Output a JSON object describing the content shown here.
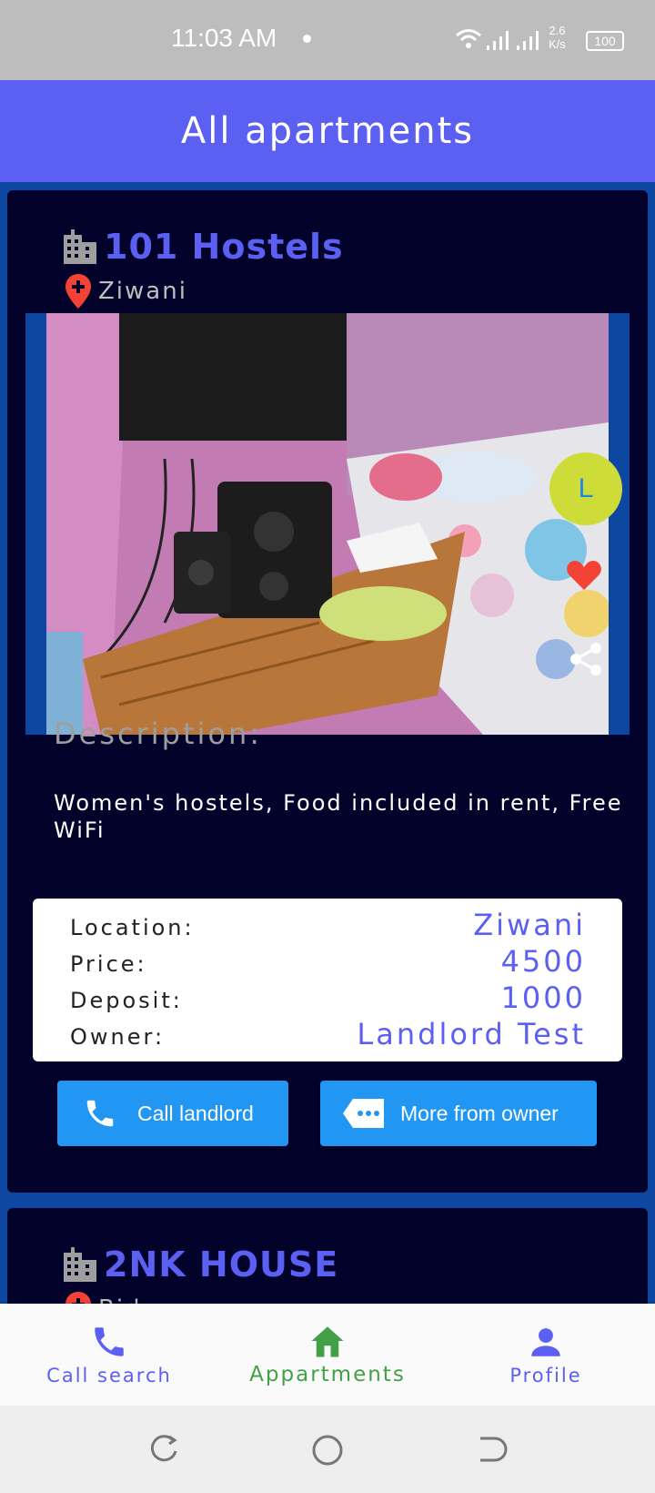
{
  "status_bar": {
    "time": "11:03 AM",
    "speed_value": "2.6",
    "speed_unit": "K/s",
    "battery": "100"
  },
  "app_bar": {
    "title": "All apartments"
  },
  "listings": [
    {
      "title": "101 Hostels",
      "location": "Ziwani",
      "owner_initial": "L",
      "description_label": "Description:",
      "description": "Women's hostels, Food included in rent, Free WiFi",
      "details": [
        {
          "label": "Location:",
          "value": "Ziwani"
        },
        {
          "label": "Price:",
          "value": "4500"
        },
        {
          "label": "Deposit:",
          "value": "1000"
        },
        {
          "label": "Owner:",
          "value": "Landlord Test"
        }
      ],
      "call_button": "Call landlord",
      "more_button": "More from owner"
    },
    {
      "title": "2NK HOUSE",
      "location": "Bid..."
    }
  ],
  "bottom_nav": [
    {
      "label": "Call search",
      "icon": "phone-icon"
    },
    {
      "label": "Appartments",
      "icon": "home-icon"
    },
    {
      "label": "Profile",
      "icon": "person-icon"
    }
  ],
  "colors": {
    "accent": "#5b5ff2",
    "card_bg": "#02022b",
    "page_bg": "#0d47a1",
    "button": "#2196f3",
    "active_nav": "#43a047",
    "avatar_bg": "#cddc39",
    "heart": "#f44336"
  }
}
